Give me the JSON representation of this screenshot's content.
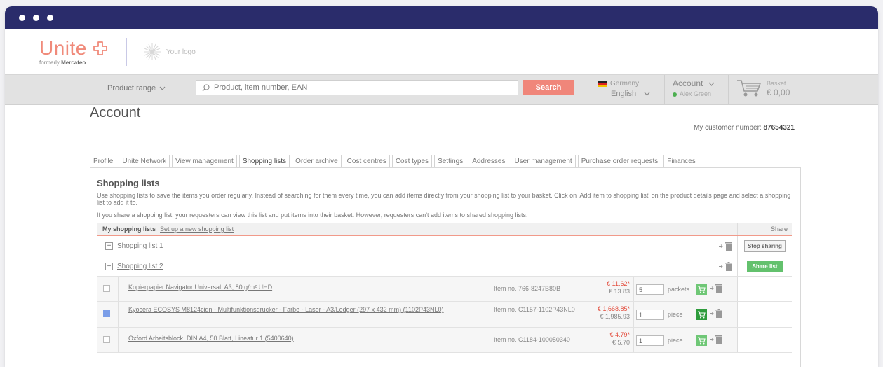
{
  "brand": {
    "logo": "Unite",
    "formerly_prefix": "formerly",
    "formerly_name": "Mercateo",
    "your_logo": "Your logo"
  },
  "nav": {
    "product_range": "Product range",
    "search_placeholder": "Product, item number, EAN",
    "search_button": "Search",
    "country": "Germany",
    "language": "English",
    "account": "Account",
    "user": "Alex Green",
    "basket_label": "Basket",
    "basket_amount": "€ 0,00"
  },
  "page": {
    "title": "Account",
    "customer_label": "My customer number:",
    "customer_number": "87654321"
  },
  "tabs": [
    {
      "label": "Profile"
    },
    {
      "label": "Unite Network"
    },
    {
      "label": "View management"
    },
    {
      "label": "Shopping lists",
      "active": true
    },
    {
      "label": "Order archive"
    },
    {
      "label": "Cost centres"
    },
    {
      "label": "Cost types"
    },
    {
      "label": "Settings"
    },
    {
      "label": "Addresses"
    },
    {
      "label": "User management"
    },
    {
      "label": "Purchase order requests"
    },
    {
      "label": "Finances"
    }
  ],
  "shopping": {
    "title": "Shopping lists",
    "desc1": "Use shopping lists to save the items you order regularly. Instead of searching for them every time, you can add items directly from your shopping list to your basket. Click on 'Add item to shopping list' on the product details page and select a shopping list to add it to.",
    "desc2": "If you share a shopping list, your requesters can view this list and put items into their basket. However, requesters can't add items to shared shopping lists.",
    "head_my": "My shopping lists",
    "head_setup": "Set up a new shopping list",
    "head_share": "Share",
    "lists": [
      {
        "name": "Shopping list 1",
        "expander": "+",
        "share_button": "Stop sharing"
      },
      {
        "name": "Shopping list 2",
        "expander": "−",
        "share_button": "Share list"
      }
    ],
    "items": [
      {
        "name": "Kopierpapier Navigator Universal, A3, 80 g/m² UHD",
        "item_no": "Item no. 766-8247B80B",
        "price_net": "€ 11.62*",
        "price_gross": "€ 13.83",
        "qty": "5",
        "unit": "packets",
        "checked": false
      },
      {
        "name": "Kyocera ECOSYS M8124cidn - Multifunktionsdrucker - Farbe - Laser - A3/Ledger (297 x 432 mm) (1102P43NL0)",
        "item_no": "Item no. C1157-1102P43NL0",
        "price_net": "€ 1,668.85*",
        "price_gross": "€ 1,985.93",
        "qty": "1",
        "unit": "piece",
        "checked": true
      },
      {
        "name": "Oxford Arbeitsblock, DIN A4, 50 Blatt, Lineatur 1 (5400640)",
        "item_no": "Item no. C1184-100050340",
        "price_net": "€ 4.79*",
        "price_gross": "€ 5.70",
        "qty": "1",
        "unit": "piece",
        "checked": false
      }
    ]
  }
}
